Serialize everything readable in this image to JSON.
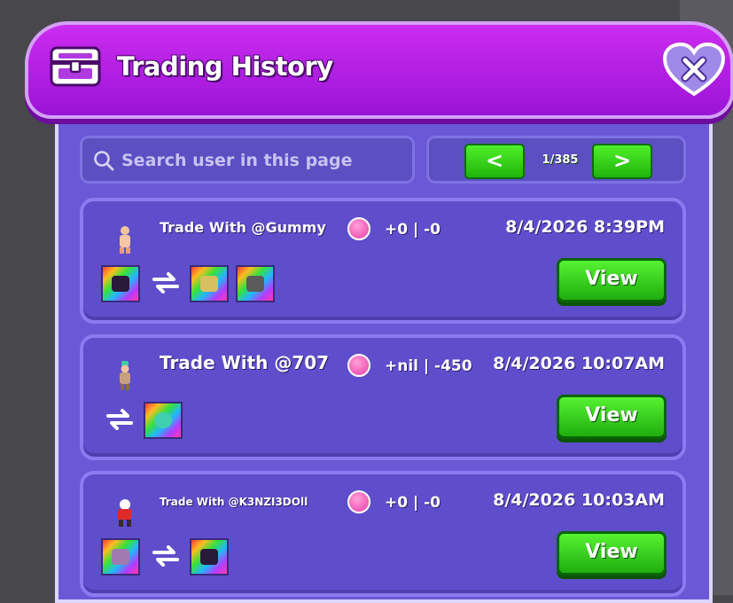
{
  "header": {
    "title": "Trading History",
    "close_icon": "close-heart-icon",
    "chest_icon": "chest-icon"
  },
  "search": {
    "placeholder": "Search user in this page",
    "value": ""
  },
  "pager": {
    "prev_label": "<",
    "next_label": ">",
    "page_text": "1/385"
  },
  "trades": [
    {
      "title": "Trade With @Gummy",
      "diff": "+0 | -0",
      "date": "8/4/2026 8:39PM",
      "view_label": "View",
      "left_items": 1,
      "right_items": 2
    },
    {
      "title": "Trade With @707",
      "diff": "+nil | -450",
      "date": "8/4/2026 10:07AM",
      "view_label": "View",
      "left_items": 0,
      "right_items": 1
    },
    {
      "title": "Trade With @K3NZI3DOll",
      "diff": "+0 | -0",
      "date": "8/4/2026 10:03AM",
      "view_label": "View",
      "left_items": 1,
      "right_items": 1
    }
  ],
  "colors": {
    "accent_green": "#2ed016",
    "panel_purple": "#6a58d6",
    "header_magenta": "#c022ee",
    "gem_pink": "#ea3ca8"
  }
}
